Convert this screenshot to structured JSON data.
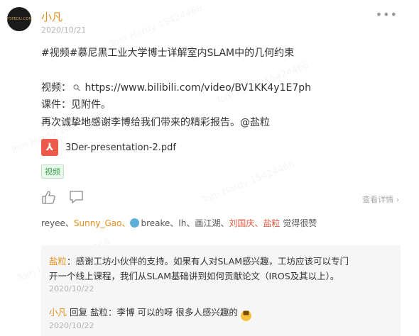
{
  "post": {
    "author": "小凡",
    "date": "2020/10/21",
    "avatar_text": "TOPEDU.COM",
    "title_line": "#视频#慕尼黑工业大学博士详解室内SLAM中的几何约束",
    "video_label": "视频：",
    "video_url": "https://www.bilibili.com/video/BV1KK4y1E7ph",
    "courseware": "课件：见附件。",
    "thanks": "再次诚挚地感谢李博给我们带来的精彩报告。@盐粒",
    "attachment": "3Der-presentation-2.pdf",
    "tag": "视频"
  },
  "actions": {
    "like_icon": "thumbs-up-icon",
    "comment_icon": "comment-bubble-icon",
    "detail_label": "查看详情"
  },
  "likes": {
    "u1": "reyee、",
    "u2": "Sunny_Gao、",
    "u3": "breake、",
    "u4": "lh、",
    "u5": "画江湖、",
    "u6": "刘国庆、",
    "u7": "盐粒",
    "suffix": " 觉得很赞"
  },
  "comments": [
    {
      "name": "盐粒",
      "sep": "：",
      "line1": "感谢工坊小伙伴的支持。如果有人对SLAM感兴趣，工坊应该可以专门",
      "line2": "开一个线上课程，我们从SLAM基础讲到如何贡献论文（IROS及其以上）。",
      "date": "2020/10/22"
    },
    {
      "name": "小凡",
      "reply_word": " 回复 ",
      "target": "盐粒",
      "text": "：李博 可以的呀 很多人感兴趣的",
      "emoji": "grinning-emoji",
      "date": "2020/10/22"
    }
  ],
  "colors": {
    "accent": "#e58e1a",
    "tag_green": "#3aa54a",
    "pdf_red": "#ee5a4a"
  }
}
